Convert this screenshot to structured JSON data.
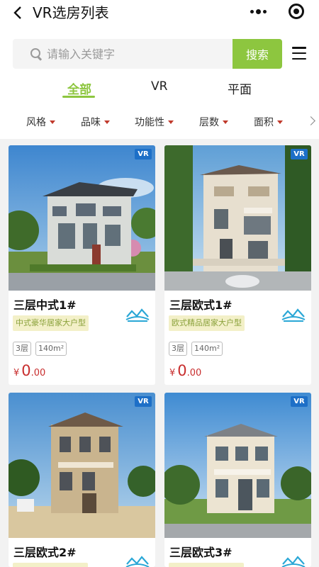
{
  "header": {
    "title": "VR选房列表"
  },
  "search": {
    "placeholder": "请输入关键字",
    "button_label": "搜索"
  },
  "tabs": [
    {
      "label": "全部",
      "active": true
    },
    {
      "label": "VR",
      "active": false
    },
    {
      "label": "平面",
      "active": false
    }
  ],
  "filters": [
    "风格",
    "品味",
    "功能性",
    "层数",
    "面积"
  ],
  "accent_color": "#8dc63f",
  "price_color": "#c82e2e",
  "cards": [
    {
      "vr_badge": "VR",
      "title": "三层中式1#",
      "tag": "中式豪华居家大户型",
      "floors": "3层",
      "area": "140m²",
      "currency": "¥",
      "price_int": "0",
      "price_dec": ".00"
    },
    {
      "vr_badge": "VR",
      "title": "三层欧式1#",
      "tag": "欧式精品居家大户型",
      "floors": "3层",
      "area": "140m²",
      "currency": "¥",
      "price_int": "0",
      "price_dec": ".00"
    },
    {
      "vr_badge": "VR",
      "title": "三层欧式2#"
    },
    {
      "vr_badge": "VR",
      "title": "三层欧式3#"
    }
  ]
}
